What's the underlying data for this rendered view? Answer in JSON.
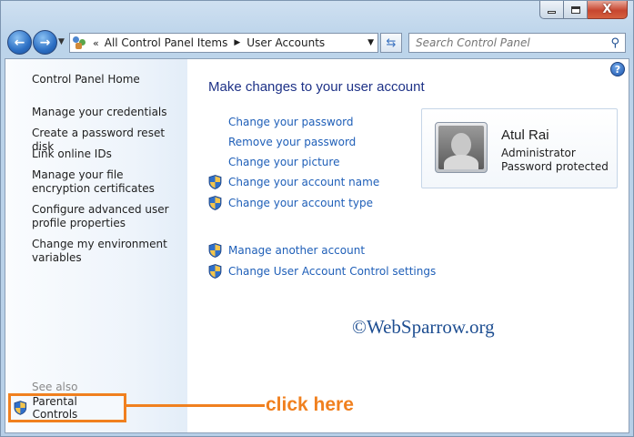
{
  "window": {
    "minimize_glyph": "minimize-icon",
    "maximize_glyph": "maximize-icon",
    "close_label": "X"
  },
  "address_bar": {
    "chevron": "«",
    "crumbs": [
      "All Control Panel Items",
      "User Accounts"
    ],
    "separator": "▶",
    "dropdown": "▼"
  },
  "search": {
    "placeholder": "Search Control Panel"
  },
  "sidebar": {
    "home": "Control Panel Home",
    "links": [
      "Manage your credentials",
      "Create a password reset disk",
      "Link online IDs",
      "Manage your file encryption certificates",
      "Configure advanced user profile properties",
      "Change my environment variables"
    ],
    "see_also": "See also",
    "parental_controls": "Parental Controls"
  },
  "main": {
    "title": "Make changes to your user account",
    "tasks": [
      {
        "label": "Change your password",
        "shield": false
      },
      {
        "label": "Remove your password",
        "shield": false
      },
      {
        "label": "Change your picture",
        "shield": false
      },
      {
        "label": "Change your account name",
        "shield": true
      },
      {
        "label": "Change your account type",
        "shield": true
      }
    ],
    "other_tasks": [
      {
        "label": "Manage another account",
        "shield": true
      },
      {
        "label": "Change User Account Control settings",
        "shield": true
      }
    ]
  },
  "account": {
    "name": "Atul Rai",
    "role": "Administrator",
    "status": "Password protected"
  },
  "annotation": {
    "callout": "click here",
    "color": "#f0801f"
  },
  "watermark": "©WebSparrow.org",
  "help_glyph": "?"
}
